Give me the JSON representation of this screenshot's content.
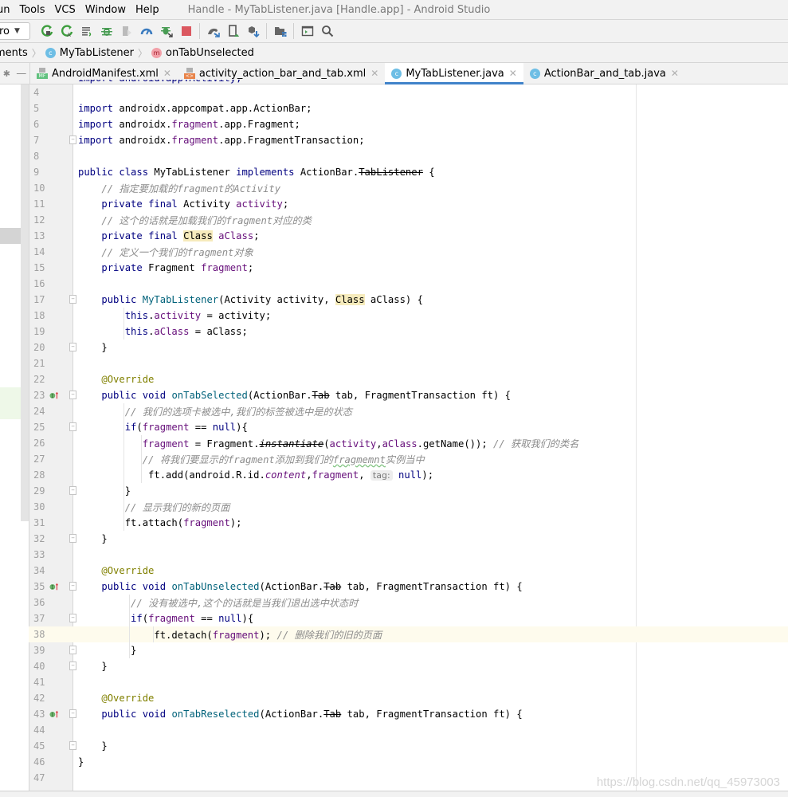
{
  "menubar": {
    "items": [
      "un",
      "Tools",
      "VCS",
      "Window",
      "Help"
    ],
    "window_title": "Handle - MyTabListener.java [Handle.app] - Android Studio"
  },
  "toolbar": {
    "config_value": "ro",
    "icons": [
      "apply-changes-restart-icon",
      "apply-code-changes-icon",
      "sync-log-icon",
      "debug-icon",
      "run-coverage-icon",
      "profile-icon",
      "attach-debugger-icon",
      "stop-icon",
      "gradle-sync-icon",
      "avd-manager-icon",
      "sdk-manager-icon",
      "project-structure-icon",
      "terminal-icon",
      "search-icon"
    ]
  },
  "breadcrumb": {
    "items": [
      {
        "label": "ments",
        "type": "folder"
      },
      {
        "label": "MyTabListener",
        "type": "class"
      },
      {
        "label": "onTabUnselected",
        "type": "method"
      }
    ]
  },
  "tabs": [
    {
      "label": "AndroidManifest.xml",
      "icon": "manifest",
      "active": false
    },
    {
      "label": "activity_action_bar_and_tab.xml",
      "icon": "layout-xml",
      "active": false
    },
    {
      "label": "MyTabListener.java",
      "icon": "class",
      "active": true
    },
    {
      "label": "ActionBar_and_tab.java",
      "icon": "class",
      "active": false
    }
  ],
  "editor": {
    "current_line": 38,
    "lines": [
      {
        "n": 4
      },
      {
        "n": 5,
        "t": "import androidx.appcompat.app.ActionBar;"
      },
      {
        "n": 6,
        "t": "import androidx.fragment.app.Fragment;"
      },
      {
        "n": 7,
        "t": "import androidx.fragment.app.FragmentTransaction;"
      },
      {
        "n": 8
      },
      {
        "n": 9,
        "t": "public class MyTabListener implements ActionBar.TabListener {"
      },
      {
        "n": 10,
        "t": "    // 指定要加载的fragment的Activity"
      },
      {
        "n": 11,
        "t": "    private final Activity activity;"
      },
      {
        "n": 12,
        "t": "    // 这个的话就是加载我们的fragment对应的类"
      },
      {
        "n": 13,
        "t": "    private final Class aClass;"
      },
      {
        "n": 14,
        "t": "    // 定义一个我们的fragment对象"
      },
      {
        "n": 15,
        "t": "    private Fragment fragment;"
      },
      {
        "n": 16
      },
      {
        "n": 17,
        "t": "    public MyTabListener(Activity activity, Class aClass) {"
      },
      {
        "n": 18,
        "t": "        this.activity = activity;"
      },
      {
        "n": 19,
        "t": "        this.aClass = aClass;"
      },
      {
        "n": 20,
        "t": "    }"
      },
      {
        "n": 21
      },
      {
        "n": 22,
        "t": "    @Override"
      },
      {
        "n": 23,
        "t": "    public void onTabSelected(ActionBar.Tab tab, FragmentTransaction ft) {"
      },
      {
        "n": 24,
        "t": "        // 我们的选项卡被选中,我们的标签被选中是的状态"
      },
      {
        "n": 25,
        "t": "        if(fragment == null){"
      },
      {
        "n": 26,
        "t": "           fragment = Fragment.instantiate(activity,aClass.getName()); // 获取我们的类名"
      },
      {
        "n": 27,
        "t": "           // 将我们要显示的fragment添加到我们的fragmemnt实例当中"
      },
      {
        "n": 28,
        "t": "            ft.add(android.R.id.content,fragment, tag: null);"
      },
      {
        "n": 29,
        "t": "        }"
      },
      {
        "n": 30,
        "t": "        // 显示我们的新的页面"
      },
      {
        "n": 31,
        "t": "        ft.attach(fragment);"
      },
      {
        "n": 32,
        "t": "    }"
      },
      {
        "n": 33
      },
      {
        "n": 34,
        "t": "    @Override"
      },
      {
        "n": 35,
        "t": "    public void onTabUnselected(ActionBar.Tab tab, FragmentTransaction ft) {"
      },
      {
        "n": 36,
        "t": "         // 没有被选中,这个的话就是当我们退出选中状态时"
      },
      {
        "n": 37,
        "t": "         if(fragment == null){"
      },
      {
        "n": 38,
        "t": "             ft.detach(fragment); // 删除我们的旧的页面"
      },
      {
        "n": 39,
        "t": "         }"
      },
      {
        "n": 40,
        "t": "    }"
      },
      {
        "n": 41
      },
      {
        "n": 42,
        "t": "    @Override"
      },
      {
        "n": 43,
        "t": "    public void onTabReselected(ActionBar.Tab tab, FragmentTransaction ft) {"
      },
      {
        "n": 44
      },
      {
        "n": 45,
        "t": "    }"
      },
      {
        "n": 46,
        "t": "}"
      },
      {
        "n": 47
      }
    ],
    "parameter_hint": "tag:"
  },
  "watermark": "https://blog.csdn.net/qq_45973003",
  "colors": {
    "keyword": "#000080",
    "field": "#660e7a",
    "method_decl": "#00627a",
    "annotation": "#808000",
    "comment": "#8c8c8c",
    "active_tab_underline": "#4083c9",
    "current_line": "#fefbed"
  }
}
